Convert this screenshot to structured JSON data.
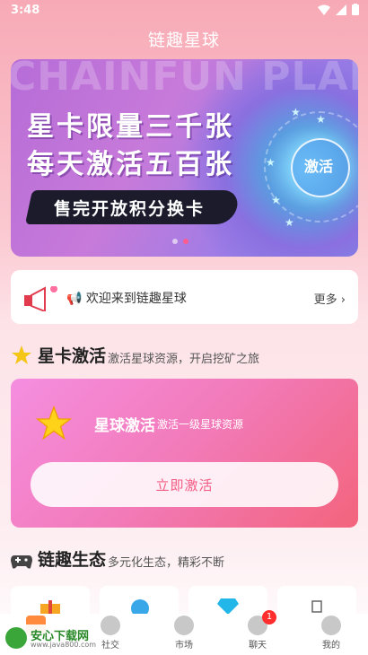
{
  "status_bar": {
    "time": "3:48"
  },
  "app": {
    "title": "链趣星球"
  },
  "banner": {
    "watermark": "CHAINFUN PLANT",
    "line1": "星卡限量三千张",
    "line2": "每天激活五百张",
    "pill_text": "售完开放积分换卡",
    "orb_text": "激活",
    "active_slide": 2,
    "slide_count": 2
  },
  "notice": {
    "text": "📢 欢迎来到链趣星球",
    "more": "更多 ›"
  },
  "star_card_section": {
    "title": "星卡激活",
    "subtitle": "激活星球资源，开启挖矿之旅"
  },
  "activation_card": {
    "title": "星球激活",
    "subtitle": "激活一级星球资源",
    "button": "立即激活"
  },
  "ecology_section": {
    "title": "链趣生态",
    "subtitle": "多元化生态，精彩不断"
  },
  "tabbar": {
    "items": [
      {
        "label": "",
        "icon": "home-icon"
      },
      {
        "label": "社交",
        "icon": "social-icon"
      },
      {
        "label": "市场",
        "icon": "market-icon"
      },
      {
        "label": "聊天",
        "icon": "chat-icon",
        "badge": "1"
      },
      {
        "label": "我的",
        "icon": "profile-icon"
      }
    ]
  },
  "watermark": {
    "title": "安心下载网",
    "url": "www.java800.com"
  },
  "colors": {
    "accent": "#f45b83",
    "badge": "#ff2d2d"
  }
}
